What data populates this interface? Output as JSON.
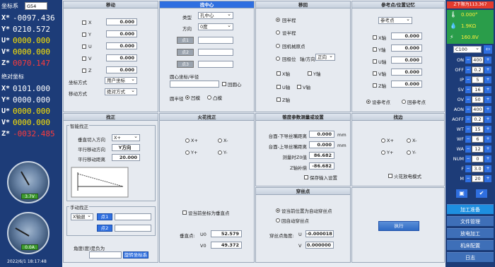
{
  "left": {
    "coord_title": "坐标系",
    "coord_system": "G54",
    "machine_axes": [
      {
        "axis": "X*",
        "value": "-0097.436",
        "color": "white"
      },
      {
        "axis": "Y*",
        "value": "0210.572",
        "color": "white"
      },
      {
        "axis": "U*",
        "value": "0000.000",
        "color": "yellow"
      },
      {
        "axis": "V*",
        "value": "0000.000",
        "color": "yellow"
      },
      {
        "axis": "Z*",
        "value": "0070.147",
        "color": "red"
      }
    ],
    "rel_title": "绝对坐标",
    "rel_axes": [
      {
        "axis": "X*",
        "value": "0101.000",
        "color": "white"
      },
      {
        "axis": "Y*",
        "value": "0000.000",
        "color": "white"
      },
      {
        "axis": "U*",
        "value": "0000.000",
        "color": "yellow"
      },
      {
        "axis": "V*",
        "value": "0000.000",
        "color": "yellow"
      },
      {
        "axis": "Z*",
        "value": "-0032.485",
        "color": "red"
      }
    ],
    "gauge1": "3.7V",
    "gauge2": "0.0A",
    "datetime": "2022/6/1  18:17:48"
  },
  "move": {
    "title": "移动",
    "axes": [
      {
        "label": "X",
        "value": "0.000"
      },
      {
        "label": "Y",
        "value": "0.000"
      },
      {
        "label": "U",
        "value": "0.000"
      },
      {
        "label": "V",
        "value": "0.000"
      },
      {
        "label": "Z",
        "value": "0.000"
      }
    ],
    "coord_mode_label": "坐标方式",
    "coord_mode": "用户坐标",
    "move_mode_label": "移动方式",
    "move_mode": "绝对方式"
  },
  "center": {
    "title": "找中心",
    "type_label": "类型",
    "type": "孔中心",
    "dir_label": "方向",
    "dir": "0度",
    "p1": "点1",
    "p2": "点2",
    "p3": "点3",
    "center_label": "圆心坐标/半径",
    "return_center": "回圆心",
    "diameter_label": "圆半径",
    "opt1": "凹模",
    "opt2": "凸模"
  },
  "home": {
    "title": "移回",
    "opt1": "回半程",
    "opt2": "设半程",
    "opt3": "回机械原点",
    "opt4": "回极位",
    "axis_dir_label": "轴/方向",
    "axis_dir": "正向",
    "cb_x": "X轴",
    "cb_y": "Y轴",
    "cb_u": "U轴",
    "cb_v": "V轴",
    "cb_z": "Z轴"
  },
  "ref": {
    "title": "参考点/位置记忆",
    "select": "参考点",
    "axes": [
      {
        "label": "X轴",
        "value": "0.000"
      },
      {
        "label": "Y轴",
        "value": "0.000"
      },
      {
        "label": "U轴",
        "value": "0.000"
      },
      {
        "label": "V轴",
        "value": "0.000"
      },
      {
        "label": "Z轴",
        "value": "0.000"
      }
    ],
    "set_ref": "设参考点",
    "go_ref": "回参考点"
  },
  "align": {
    "title": "找正",
    "smart_label": "智能找正",
    "vert_dir_label": "垂直切入方向",
    "vert_dir": "X+",
    "par_dir_label": "平行移动方向",
    "par_dir": "Y方向",
    "par_dist_label": "平行移动距离",
    "par_dist": "20.000",
    "manual_label": "手动找正",
    "manual_axis": "X轴退",
    "p1": "点1",
    "p2": "点2",
    "angle_label": "角度(度)是负为",
    "rotate_btn": "旋转坐标系"
  },
  "spark": {
    "title": "火花找正",
    "xp": "X+",
    "xm": "X-",
    "yp": "Y+",
    "ym": "Y-",
    "set_center": "设当前坐标为垂直点",
    "vpt_label": "垂直点:",
    "u0": "U0",
    "v0": "V0",
    "u0_val": "52.579",
    "v0_val": "49.372"
  },
  "taper": {
    "title": "锥度参数测量或设置",
    "r1_label": "台面-下导丝嘴距离",
    "r1": "0.000",
    "unit": "mm",
    "r2_label": "台面-上导丝嘴距离",
    "r2": "0.000",
    "r3_label": "测量时Z0值",
    "r3": "86.682",
    "r4_label": "Z轴补偿",
    "r4": "-86.682",
    "save": "保存输入设置"
  },
  "thread": {
    "title": "穿丝点",
    "opt1": "设当前位置为自动穿丝点",
    "opt2": "回自动穿丝点",
    "angle_label": "穿丝点角度:",
    "u": "U",
    "v": "V",
    "u_val": "-0.000018",
    "v_val": "0.000000"
  },
  "edge": {
    "title": "找边",
    "xp": "X+",
    "xm": "X-",
    "yp": "Y+",
    "ym": "Y-",
    "spark_mode": "火花放电模式"
  },
  "exec": {
    "label": "执行"
  },
  "right": {
    "alarm": "Z下限为113.367",
    "temp": "0.000°",
    "res": "1.9KΩ",
    "volt": "160.8V",
    "mode": "C100",
    "params": [
      {
        "label": "ON",
        "value": "400"
      },
      {
        "label": "OFF",
        "value": "0.2"
      },
      {
        "label": "IP",
        "value": "5"
      },
      {
        "label": "SV",
        "value": "16"
      },
      {
        "label": "OV",
        "value": "50"
      },
      {
        "label": "AON",
        "value": "400"
      },
      {
        "label": "AOFF",
        "value": "0.2"
      },
      {
        "label": "WT",
        "value": "15"
      },
      {
        "label": "WF",
        "value": "6"
      },
      {
        "label": "WA",
        "value": "12"
      },
      {
        "label": "NUM",
        "value": "0"
      },
      {
        "label": "F",
        "value": "3.0"
      },
      {
        "label": "M",
        "value": "20"
      }
    ],
    "menu": [
      "加工准备",
      "文件管理",
      "放电加工",
      "机床配置",
      "日志"
    ]
  }
}
